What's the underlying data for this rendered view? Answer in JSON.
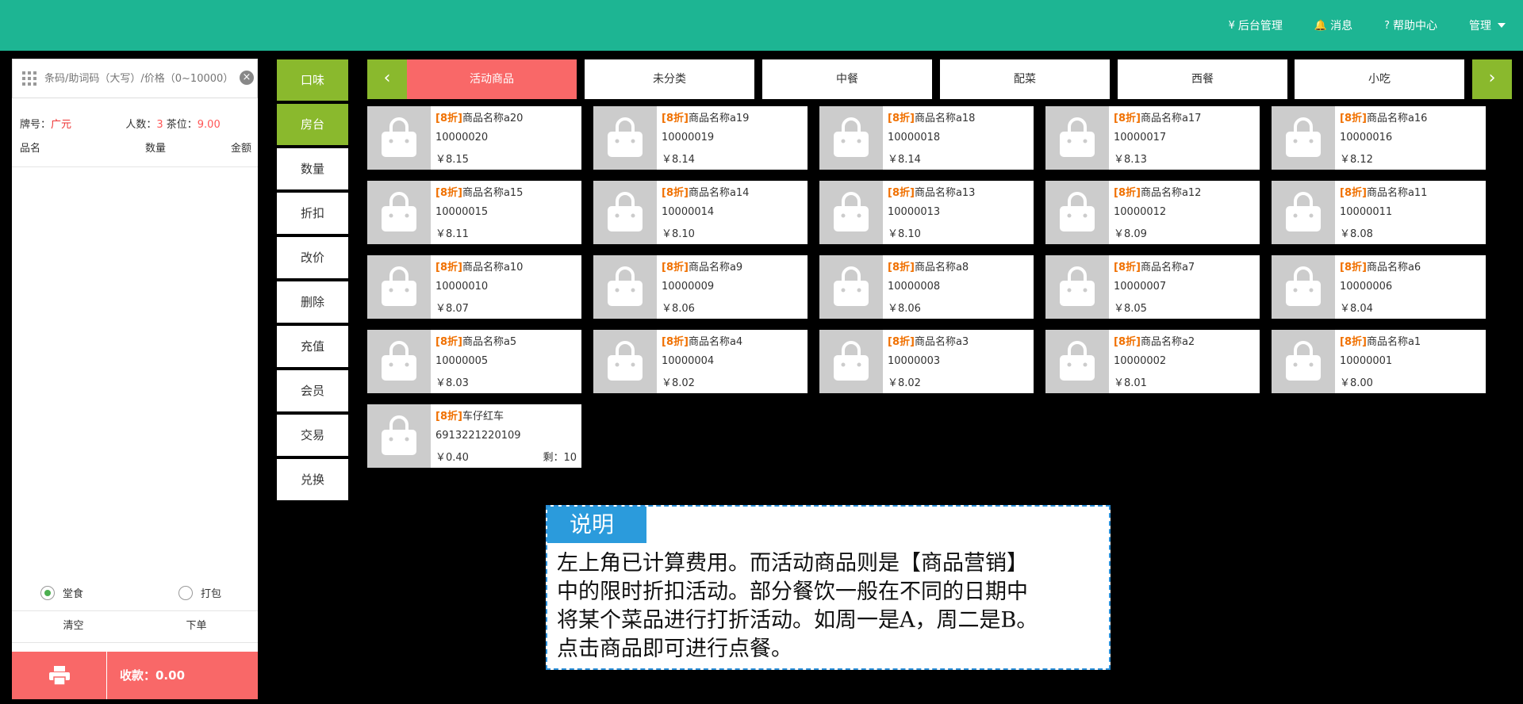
{
  "topnav": {
    "backend": "后台管理",
    "messages": "消息",
    "help": "帮助中心",
    "manage": "管理"
  },
  "left": {
    "search_placeholder": "条码/助词码（大写）/价格（0~10000）",
    "plate_label": "牌号：",
    "plate_value": "广元",
    "people_label": "人数：",
    "people_value": "3",
    "tea_label": "茶位：",
    "tea_value": "9.00",
    "col_name": "品名",
    "col_qty": "数量",
    "col_amount": "金额",
    "dine_in": "堂食",
    "takeaway": "打包",
    "clear": "清空",
    "place_order": "下单",
    "total": "收款：0.00"
  },
  "functions": [
    "口味",
    "房台",
    "数量",
    "折扣",
    "改价",
    "删除",
    "充值",
    "会员",
    "交易",
    "兑换"
  ],
  "categories": [
    "活动商品",
    "未分类",
    "中餐",
    "配菜",
    "西餐",
    "小吃"
  ],
  "products": [
    {
      "tag": "[8折]",
      "name": "商品名称a20",
      "code": "10000020",
      "price": "￥8.15",
      "stock": ""
    },
    {
      "tag": "[8折]",
      "name": "商品名称a19",
      "code": "10000019",
      "price": "￥8.14",
      "stock": ""
    },
    {
      "tag": "[8折]",
      "name": "商品名称a18",
      "code": "10000018",
      "price": "￥8.14",
      "stock": ""
    },
    {
      "tag": "[8折]",
      "name": "商品名称a17",
      "code": "10000017",
      "price": "￥8.13",
      "stock": ""
    },
    {
      "tag": "[8折]",
      "name": "商品名称a16",
      "code": "10000016",
      "price": "￥8.12",
      "stock": ""
    },
    {
      "tag": "[8折]",
      "name": "商品名称a15",
      "code": "10000015",
      "price": "￥8.11",
      "stock": ""
    },
    {
      "tag": "[8折]",
      "name": "商品名称a14",
      "code": "10000014",
      "price": "￥8.10",
      "stock": ""
    },
    {
      "tag": "[8折]",
      "name": "商品名称a13",
      "code": "10000013",
      "price": "￥8.10",
      "stock": ""
    },
    {
      "tag": "[8折]",
      "name": "商品名称a12",
      "code": "10000012",
      "price": "￥8.09",
      "stock": ""
    },
    {
      "tag": "[8折]",
      "name": "商品名称a11",
      "code": "10000011",
      "price": "￥8.08",
      "stock": ""
    },
    {
      "tag": "[8折]",
      "name": "商品名称a10",
      "code": "10000010",
      "price": "￥8.07",
      "stock": ""
    },
    {
      "tag": "[8折]",
      "name": "商品名称a9",
      "code": "10000009",
      "price": "￥8.06",
      "stock": ""
    },
    {
      "tag": "[8折]",
      "name": "商品名称a8",
      "code": "10000008",
      "price": "￥8.06",
      "stock": ""
    },
    {
      "tag": "[8折]",
      "name": "商品名称a7",
      "code": "10000007",
      "price": "￥8.05",
      "stock": ""
    },
    {
      "tag": "[8折]",
      "name": "商品名称a6",
      "code": "10000006",
      "price": "￥8.04",
      "stock": ""
    },
    {
      "tag": "[8折]",
      "name": "商品名称a5",
      "code": "10000005",
      "price": "￥8.03",
      "stock": ""
    },
    {
      "tag": "[8折]",
      "name": "商品名称a4",
      "code": "10000004",
      "price": "￥8.02",
      "stock": ""
    },
    {
      "tag": "[8折]",
      "name": "商品名称a3",
      "code": "10000003",
      "price": "￥8.02",
      "stock": ""
    },
    {
      "tag": "[8折]",
      "name": "商品名称a2",
      "code": "10000002",
      "price": "￥8.01",
      "stock": ""
    },
    {
      "tag": "[8折]",
      "name": "商品名称a1",
      "code": "10000001",
      "price": "￥8.00",
      "stock": ""
    },
    {
      "tag": "[8折]",
      "name": "车仔红车",
      "code": "6913221220109",
      "price": "￥0.40",
      "stock": "剩：10"
    }
  ],
  "note": {
    "title": "说明",
    "lines": [
      "左上角已计算费用。而活动商品则是【商品营销】",
      "中的限时折扣活动。部分餐饮一般在不同的日期中",
      "将某个菜品进行打折活动。如周一是A，周二是B。",
      "点击商品即可进行点餐。"
    ]
  },
  "colors": {
    "topbar": "#1db593",
    "accent_green": "#8ab92d",
    "accent_red": "#f96868",
    "discount_tag": "#f07000",
    "note_blue": "#2b9bdc"
  }
}
